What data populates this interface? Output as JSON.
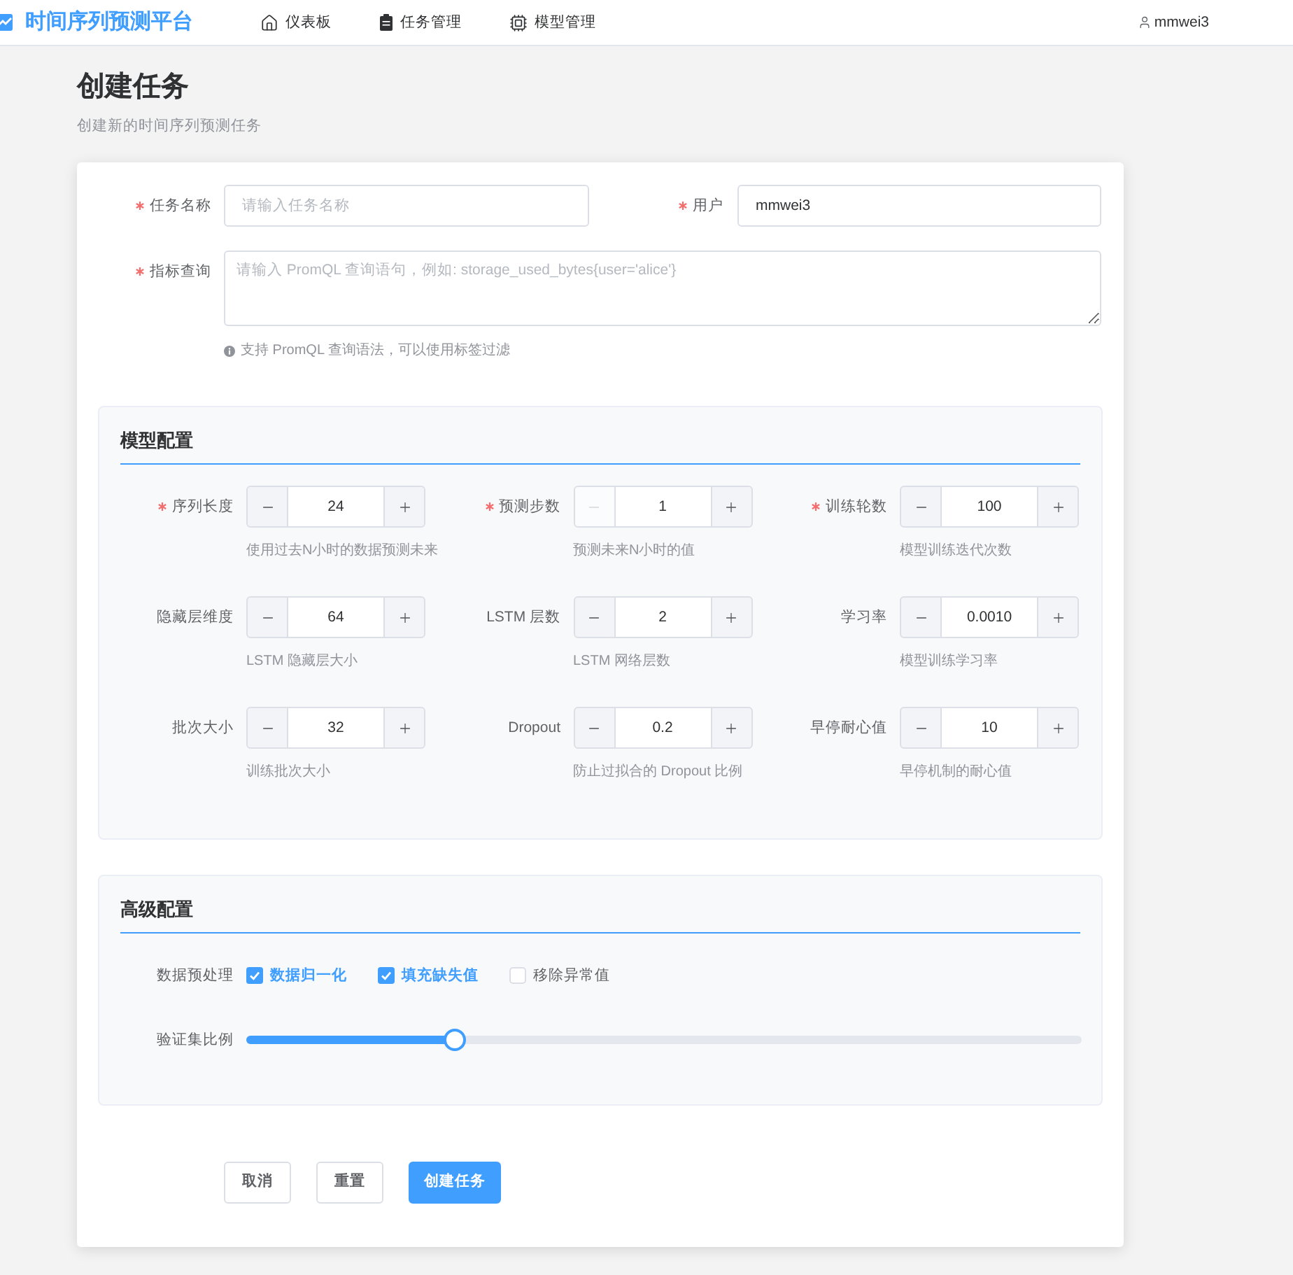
{
  "header": {
    "logo": "时间序列预测平台",
    "nav": [
      {
        "label": "仪表板"
      },
      {
        "label": "任务管理"
      },
      {
        "label": "模型管理"
      }
    ],
    "user": "mmwei3"
  },
  "page": {
    "title": "创建任务",
    "subtitle": "创建新的时间序列预测任务"
  },
  "form": {
    "fields": [
      {
        "label": "任务名称",
        "required": true,
        "placeholder": "请输入任务名称"
      },
      {
        "label": "用户",
        "required": true,
        "value": "mmwei3"
      }
    ],
    "query": {
      "label": "指标查询",
      "required": true,
      "placeholder": "请输入 PromQL 查询语句，例如: storage_used_bytes{user='alice'}",
      "hint": "支持 PromQL 查询语法，可以使用标签过滤"
    }
  },
  "model_config": {
    "title": "模型配置",
    "params": [
      {
        "label": "序列长度",
        "required": true,
        "value": "24",
        "hint": "使用过去N小时的数据预测未来",
        "minus_disabled": false
      },
      {
        "label": "预测步数",
        "required": true,
        "value": "1",
        "hint": "预测未来N小时的值",
        "minus_disabled": true
      },
      {
        "label": "训练轮数",
        "required": true,
        "value": "100",
        "hint": "模型训练迭代次数",
        "minus_disabled": false
      },
      {
        "label": "隐藏层维度",
        "required": false,
        "value": "64",
        "hint": "LSTM 隐藏层大小",
        "minus_disabled": false
      },
      {
        "label": "LSTM 层数",
        "required": false,
        "value": "2",
        "hint": "LSTM 网络层数",
        "minus_disabled": false
      },
      {
        "label": "学习率",
        "required": false,
        "value": "0.0010",
        "hint": "模型训练学习率",
        "minus_disabled": false
      },
      {
        "label": "批次大小",
        "required": false,
        "value": "32",
        "hint": "训练批次大小",
        "minus_disabled": false
      },
      {
        "label": "Dropout",
        "required": false,
        "value": "0.2",
        "hint": "防止过拟合的 Dropout 比例",
        "minus_disabled": false
      },
      {
        "label": "早停耐心值",
        "required": false,
        "value": "10",
        "hint": "早停机制的耐心值",
        "minus_disabled": false
      }
    ]
  },
  "advanced_config": {
    "title": "高级配置",
    "preprocessing": {
      "label": "数据预处理",
      "options": [
        {
          "label": "数据归一化",
          "checked": true
        },
        {
          "label": "填充缺失值",
          "checked": true
        },
        {
          "label": "移除异常值",
          "checked": false
        }
      ]
    },
    "validation_split": {
      "label": "验证集比例",
      "level": 0.25
    }
  },
  "buttons": [
    {
      "label": "取消",
      "kind": "default"
    },
    {
      "label": "重置",
      "kind": "default"
    },
    {
      "label": "创建任务",
      "kind": "primary"
    }
  ]
}
